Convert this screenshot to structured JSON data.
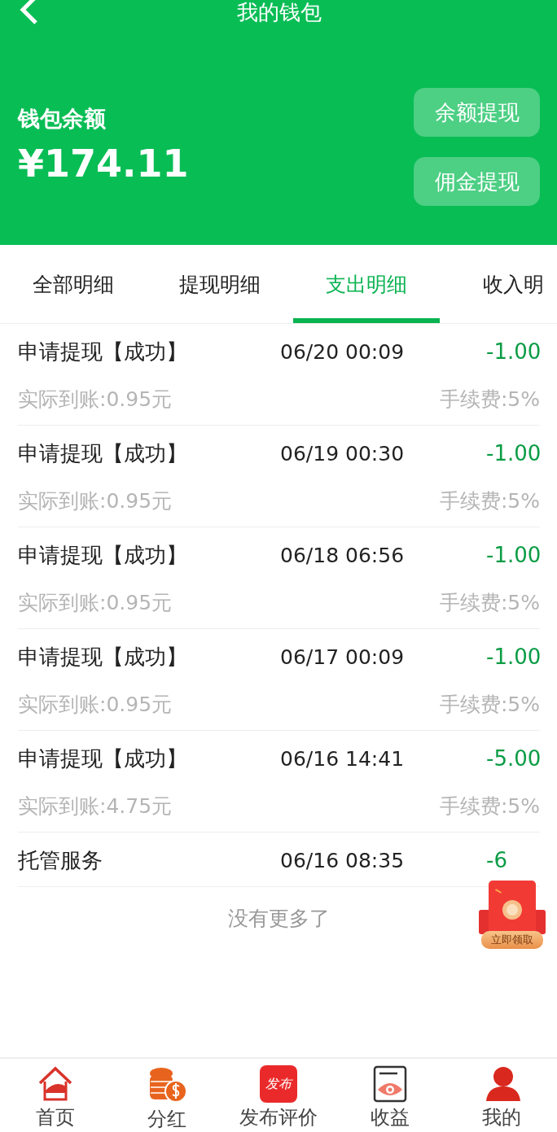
{
  "header": {
    "title": "我的钱包",
    "balance_label": "钱包余额",
    "balance": "¥174.11",
    "buttons": [
      "余额提现",
      "佣金提现"
    ]
  },
  "tabs": [
    {
      "label": "全部明细",
      "selected": false
    },
    {
      "label": "提现明细",
      "selected": false
    },
    {
      "label": "支出明细",
      "selected": true
    },
    {
      "label": "收入明",
      "selected": false
    }
  ],
  "records": [
    {
      "title": "申请提现【成功】",
      "time": "06/20 00:09",
      "amount": "-1.00",
      "received": "实际到账:0.95元",
      "fee": "手续费:5%"
    },
    {
      "title": "申请提现【成功】",
      "time": "06/19 00:30",
      "amount": "-1.00",
      "received": "实际到账:0.95元",
      "fee": "手续费:5%"
    },
    {
      "title": "申请提现【成功】",
      "time": "06/18 06:56",
      "amount": "-1.00",
      "received": "实际到账:0.95元",
      "fee": "手续费:5%"
    },
    {
      "title": "申请提现【成功】",
      "time": "06/17 00:09",
      "amount": "-1.00",
      "received": "实际到账:0.95元",
      "fee": "手续费:5%"
    },
    {
      "title": "申请提现【成功】",
      "time": "06/16 14:41",
      "amount": "-5.00",
      "received": "实际到账:4.75元",
      "fee": "手续费:5%"
    },
    {
      "title": "托管服务",
      "time": "06/16 08:35",
      "amount": "-6"
    }
  ],
  "end_note": "没有更多了",
  "red_packet": {
    "label": "立即领取"
  },
  "nav": [
    {
      "label": "首页",
      "kind": "home"
    },
    {
      "label": "分红",
      "kind": "coins"
    },
    {
      "label": "发布评价",
      "kind": "publish",
      "icon_text": "发布"
    },
    {
      "label": "收益",
      "kind": "earnings"
    },
    {
      "label": "我的",
      "kind": "profile"
    }
  ]
}
